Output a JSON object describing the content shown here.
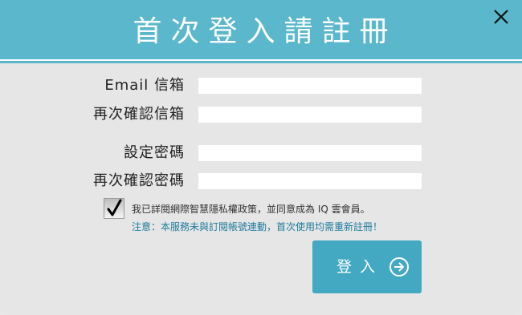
{
  "dialog": {
    "title": "首次登入請註冊",
    "close_icon": "close-icon"
  },
  "form": {
    "email_label": "Email 信箱",
    "email_confirm_label": "再次確認信箱",
    "password_label": "設定密碼",
    "password_confirm_label": "再次確認密碼",
    "email_value": "",
    "email_confirm_value": "",
    "password_value": "",
    "password_confirm_value": ""
  },
  "agreement": {
    "checked": true,
    "text": "我已詳閱網際智慧隱私權政策，並同意成為 IQ 雲會員。",
    "notice": "注意：本服務未與訂閱帳號連動，首次使用均需重新註冊！"
  },
  "submit": {
    "label": "登入",
    "icon": "arrow-circle-right-icon"
  },
  "colors": {
    "header": "#5ab7cc",
    "button": "#43a8c1",
    "notice": "#1f7a9c",
    "background": "#e6e6e6"
  }
}
